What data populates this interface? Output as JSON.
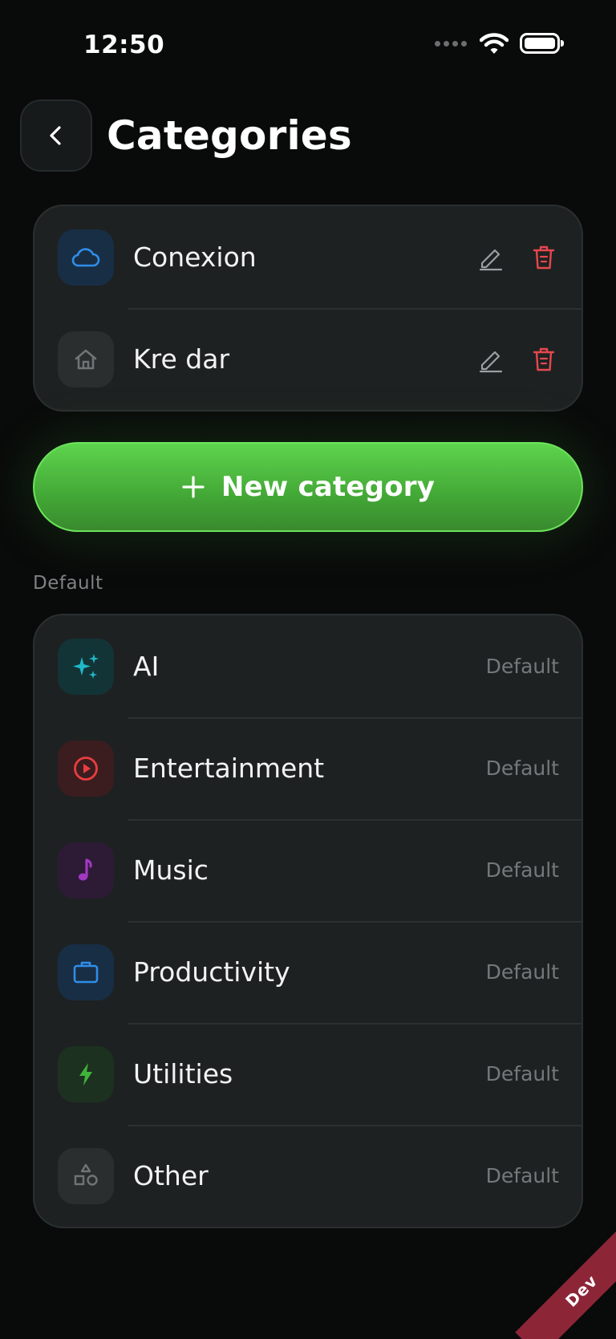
{
  "status_bar": {
    "time": "12:50"
  },
  "header": {
    "title": "Categories"
  },
  "custom_categories": [
    {
      "label": "Conexion",
      "icon": "cloud-icon",
      "tile_color": "#182e45",
      "icon_color": "#2f8eea"
    },
    {
      "label": "Kre dar",
      "icon": "home-icon",
      "tile_color": "#2b2e2f",
      "icon_color": "#6f7475"
    }
  ],
  "new_category_button": {
    "label": "New category",
    "color": "#4cbb3f"
  },
  "default_section": {
    "title": "Default",
    "items": [
      {
        "label": "AI",
        "badge": "Default",
        "icon": "sparkles-icon",
        "tile_color": "#133437",
        "icon_color": "#1fb8c7"
      },
      {
        "label": "Entertainment",
        "badge": "Default",
        "icon": "play-circle-icon",
        "tile_color": "#3b1d1f",
        "icon_color": "#ea3d40"
      },
      {
        "label": "Music",
        "badge": "Default",
        "icon": "music-note-icon",
        "tile_color": "#2d1b36",
        "icon_color": "#a338c2"
      },
      {
        "label": "Productivity",
        "badge": "Default",
        "icon": "briefcase-icon",
        "tile_color": "#182e45",
        "icon_color": "#2f8eea"
      },
      {
        "label": "Utilities",
        "badge": "Default",
        "icon": "lightning-icon",
        "tile_color": "#1d3120",
        "icon_color": "#3fb53a"
      },
      {
        "label": "Other",
        "badge": "Default",
        "icon": "shapes-icon",
        "tile_color": "#2b2e2f",
        "icon_color": "#6f7475"
      }
    ]
  },
  "dev_badge": {
    "label": "Dev"
  },
  "colors": {
    "background": "#090a0a",
    "card": "#1e2122",
    "delete": "#e5484d",
    "edit": "#9aa0a1"
  }
}
